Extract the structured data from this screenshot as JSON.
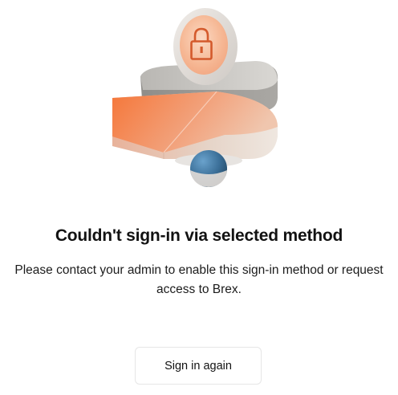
{
  "illustration": {
    "icon": "lock-icon",
    "accent_color": "#f47e4b"
  },
  "error": {
    "title": "Couldn't sign-in via selected method",
    "message": "Please contact your admin to enable this sign-in method or request access to Brex."
  },
  "actions": {
    "sign_in_again_label": "Sign in again"
  }
}
